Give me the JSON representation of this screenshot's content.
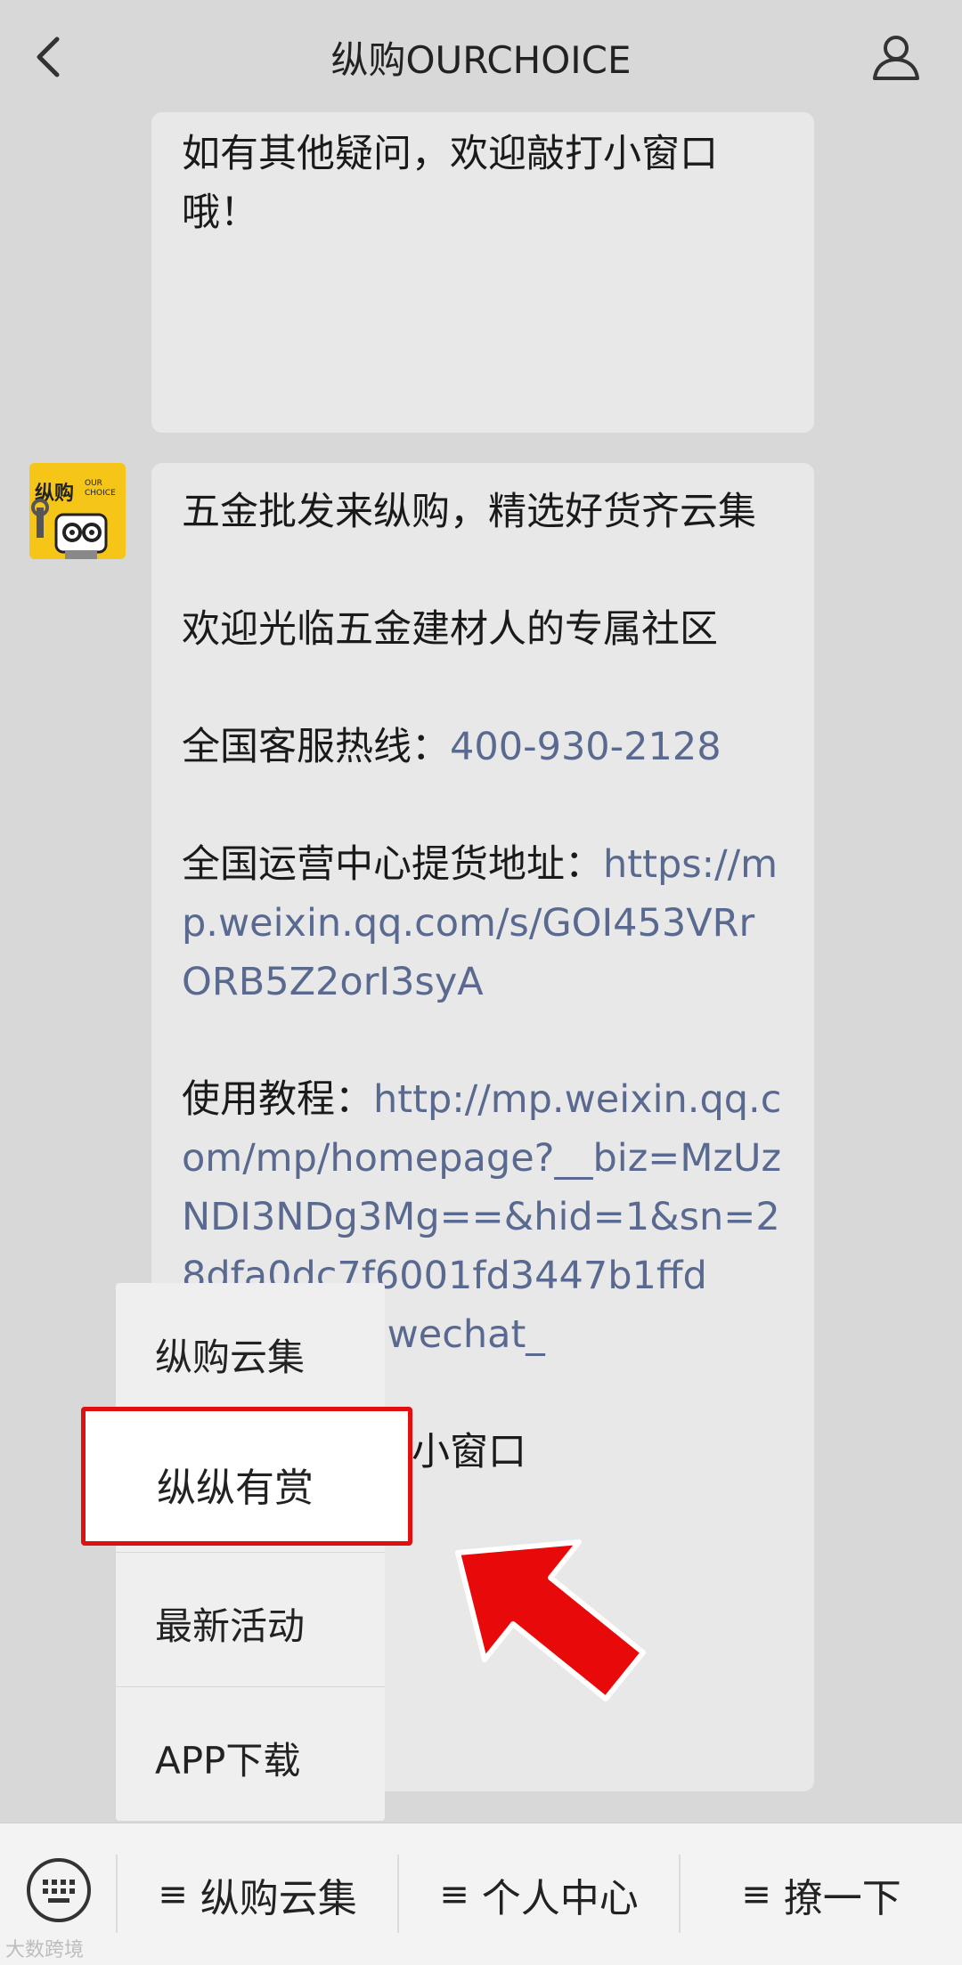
{
  "header": {
    "title": "纵购OURCHOICE",
    "back_icon": "chevron-left-icon",
    "profile_icon": "user-icon"
  },
  "messages": {
    "first_bubble": "如有其他疑问，欢迎敲打小窗口哦！",
    "avatar": {
      "brand": "纵购",
      "sub": "OUR CHOICE"
    },
    "second_bubble": {
      "line1": "五金批发来纵购，精选好货齐云集",
      "line2": "欢迎光临五金建材人的专属社区",
      "hotline_label": "全国客服热线：",
      "hotline_number": "400-930-2128",
      "address_label": "全国运营中心提货地址：",
      "address_link": "https://mp.weixin.qq.com/s/GOI453VRrORB5Z2orI3syA",
      "tutorial_label": "使用教程：",
      "tutorial_link": "http://mp.weixin.qq.com/mp/homepage?__biz=MzUzNDI3NDg3Mg==&hid=1&sn=28dfa0dc7f6001fd3447b1ffd",
      "tutorial_link_visible_end": "cene=18#wechat_",
      "closing_visible": "问，欢迎敲打小窗口"
    }
  },
  "popup_menu": {
    "items": [
      {
        "label": "纵购云集"
      },
      {
        "label": "纵纵有赏"
      },
      {
        "label": "最新活动"
      },
      {
        "label": "APP下载"
      }
    ],
    "highlight_color": "#e01010"
  },
  "bottom_menu": {
    "keyboard_icon": "keyboard-icon",
    "buttons": [
      {
        "label": "纵购云集"
      },
      {
        "label": "个人中心"
      },
      {
        "label": "撩一下"
      }
    ],
    "menu_glyph": "≡"
  },
  "watermark": "大数跨境"
}
